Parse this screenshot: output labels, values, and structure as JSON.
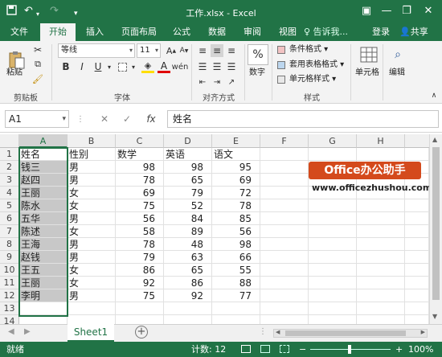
{
  "app": {
    "title": "工作.xlsx - Excel",
    "quick_access": [
      "save-icon",
      "undo-icon",
      "redo-icon",
      "customize-icon"
    ],
    "window_controls": [
      "ribbon-options-icon",
      "minimize-icon",
      "restore-icon",
      "close-icon"
    ],
    "accent": "#217346"
  },
  "tabs": {
    "items": [
      "文件",
      "开始",
      "插入",
      "页面布局",
      "公式",
      "数据",
      "审阅",
      "视图"
    ],
    "active": "开始",
    "tell_me": "♀ 告诉我...",
    "login": "登录",
    "share": "共享"
  },
  "ribbon": {
    "clipboard": {
      "paste": "粘贴",
      "label": "剪贴板"
    },
    "font": {
      "name": "等线",
      "size": "11",
      "label": "字体"
    },
    "alignment": {
      "label": "对齐方式"
    },
    "number": {
      "button": "数字"
    },
    "styles": {
      "conditional": "条件格式 ▾",
      "table_format": "套用表格格式 ▾",
      "cell_styles": "单元格样式 ▾",
      "label": "样式"
    },
    "cells": {
      "button": "单元格"
    },
    "editing": {
      "button": "编辑"
    }
  },
  "formula_bar": {
    "name_box": "A1",
    "fx": "fx",
    "value": "姓名"
  },
  "sheet": {
    "columns": [
      "A",
      "B",
      "C",
      "D",
      "E",
      "F",
      "G",
      "H"
    ],
    "rows": [
      [
        "姓名",
        "性别",
        "数学",
        "英语",
        "语文"
      ],
      [
        "钱三",
        "男",
        "98",
        "98",
        "95"
      ],
      [
        "赵四",
        "男",
        "78",
        "65",
        "69"
      ],
      [
        "王丽",
        "女",
        "69",
        "79",
        "72"
      ],
      [
        "陈水",
        "女",
        "75",
        "52",
        "78"
      ],
      [
        "五华",
        "男",
        "56",
        "84",
        "85"
      ],
      [
        "陈述",
        "女",
        "58",
        "89",
        "56"
      ],
      [
        "王海",
        "男",
        "78",
        "48",
        "98"
      ],
      [
        "赵钱",
        "男",
        "79",
        "63",
        "66"
      ],
      [
        "王五",
        "女",
        "86",
        "65",
        "55"
      ],
      [
        "王丽",
        "女",
        "92",
        "86",
        "88"
      ],
      [
        "李明",
        "男",
        "75",
        "92",
        "77"
      ]
    ],
    "row_numbers": [
      "1",
      "2",
      "3",
      "4",
      "5",
      "6",
      "7",
      "8",
      "9",
      "10",
      "11",
      "12",
      "13",
      "14"
    ],
    "watermark_title": "Office办公助手",
    "watermark_url": "www.officezhushou.com"
  },
  "sheet_tabs": {
    "active": "Sheet1"
  },
  "status": {
    "mode": "就绪",
    "count": "计数: 12",
    "zoom": "100%"
  }
}
